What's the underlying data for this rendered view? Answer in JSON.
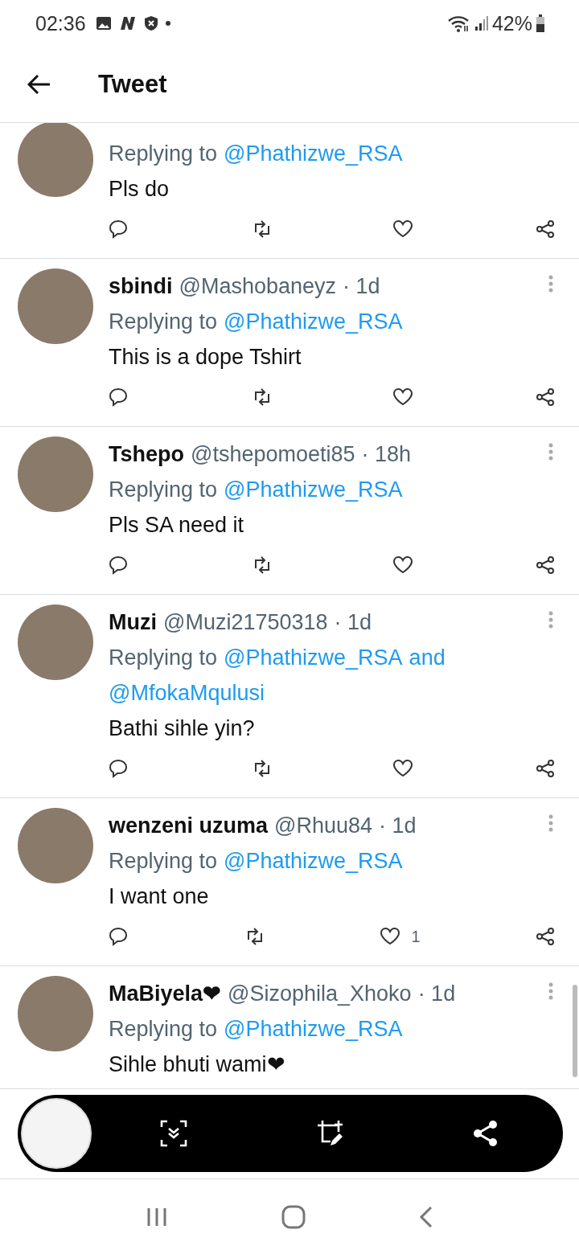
{
  "status_bar": {
    "time": "02:36",
    "battery": "42%"
  },
  "header": {
    "title": "Tweet"
  },
  "tweets": [
    {
      "replying_label": "Replying to",
      "mentions": [
        "@Phathizwe_RSA"
      ],
      "text": "Pls do"
    },
    {
      "name": "sbindi",
      "handle": "@Mashobaneyz",
      "age": "· 1d",
      "replying_label": "Replying to",
      "mentions": [
        "@Phathizwe_RSA"
      ],
      "text": "This is a dope Tshirt"
    },
    {
      "name": "Tshepo",
      "handle": "@tshepomoeti85",
      "age": "· 18h",
      "replying_label": "Replying to",
      "mentions": [
        "@Phathizwe_RSA"
      ],
      "text": "Pls SA need it"
    },
    {
      "name": "Muzi",
      "handle": "@Muzi21750318",
      "age": "· 1d",
      "replying_label": "Replying to",
      "mentions": [
        "@Phathizwe_RSA",
        "and",
        "@MfokaMqulusi"
      ],
      "text": "Bathi sihle yin?"
    },
    {
      "name": "wenzeni uzuma",
      "handle": "@Rhuu84",
      "age": "· 1d",
      "replying_label": "Replying to",
      "mentions": [
        "@Phathizwe_RSA"
      ],
      "text": "I want one",
      "likes": "1"
    },
    {
      "name": "MaBiyela❤",
      "handle": "@Sizophila_Xhoko",
      "age": "· 1d",
      "replying_label": "Replying to",
      "mentions": [
        "@Phathizwe_RSA"
      ],
      "text": "Sihle bhuti wami❤"
    }
  ]
}
